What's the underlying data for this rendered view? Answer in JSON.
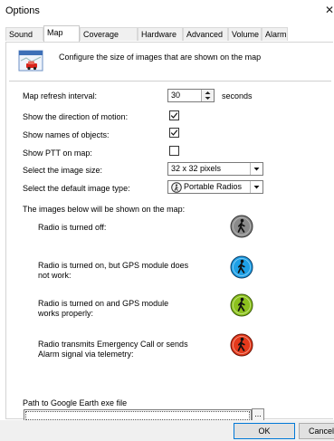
{
  "window": {
    "title": "Options"
  },
  "tabs": [
    "Sound",
    "Map",
    "Coverage Map",
    "Hardware",
    "Advanced",
    "Volume",
    "Alarm"
  ],
  "active_tab": "Map",
  "header": {
    "text": "Configure the size of images that are shown on the map",
    "icon": "map-car-icon"
  },
  "settings": {
    "refresh_label": "Map refresh interval:",
    "refresh_value": "30",
    "refresh_unit": "seconds",
    "motion_label": "Show the direction of motion:",
    "motion_checked": true,
    "names_label": "Show names of objects:",
    "names_checked": true,
    "ptt_label": "Show PTT on map:",
    "ptt_checked": false,
    "size_label": "Select the image size:",
    "size_value": "32 x 32 pixels",
    "type_label": "Select the default image type:",
    "type_value": "Portable Radios"
  },
  "images": {
    "heading": "The images below will be shown on the map:",
    "items": [
      {
        "label": "Radio is turned off:",
        "color": "#8a8a8a"
      },
      {
        "label": "Radio is turned on, but GPS module does not work:",
        "color": "#1ea0e6"
      },
      {
        "label": "Radio is turned on and GPS module works properly:",
        "color": "#8cc11e"
      },
      {
        "label": "Radio transmits Emergency Call or sends Alarm signal via telemetry:",
        "color": "#e4391b"
      }
    ]
  },
  "path": {
    "label": "Path to Google Earth exe file",
    "value": "",
    "browse_label": "..."
  },
  "buttons": {
    "ok": "OK",
    "cancel": "Cancel"
  }
}
